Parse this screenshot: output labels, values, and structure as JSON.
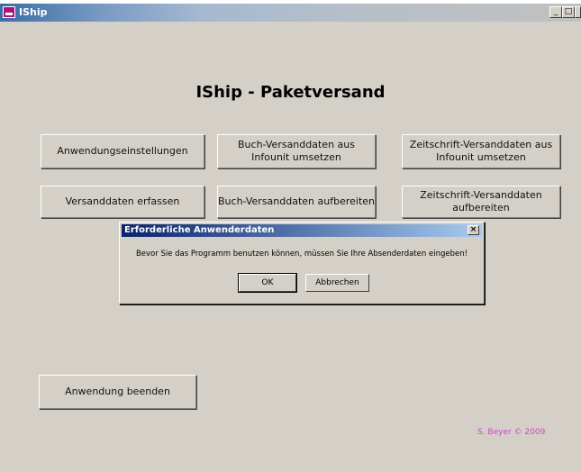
{
  "window": {
    "title": "IShip",
    "controls": {
      "minimize": "_",
      "maximize": "□",
      "close": "×"
    }
  },
  "main": {
    "heading": "IShip - Paketversand",
    "buttons": {
      "settings": "Anwendungseinstellungen",
      "book_convert": "Buch-Versanddaten aus\nInfounit umsetzen",
      "magazine_convert": "Zeitschrift-Versanddaten aus\nInfounit umsetzen",
      "capture": "Versanddaten erfassen",
      "book_prepare": "Buch-Versanddaten aufbereiten",
      "magazine_prepare": "Zeitschrift-Versanddaten\naufbereiten",
      "quit": "Anwendung beenden"
    },
    "copyright": "S. Beyer © 2009"
  },
  "dialog": {
    "title": "Erforderliche Anwenderdaten",
    "message": "Bevor Sie das Programm benutzen können, müssen Sie Ihre Absenderdaten eingeben!",
    "ok": "OK",
    "cancel": "Abbrechen",
    "close": "×"
  },
  "colors": {
    "window_bg": "#d4d0c8",
    "dialog_title": "#0a246a",
    "copyright": "#d23fd2"
  }
}
